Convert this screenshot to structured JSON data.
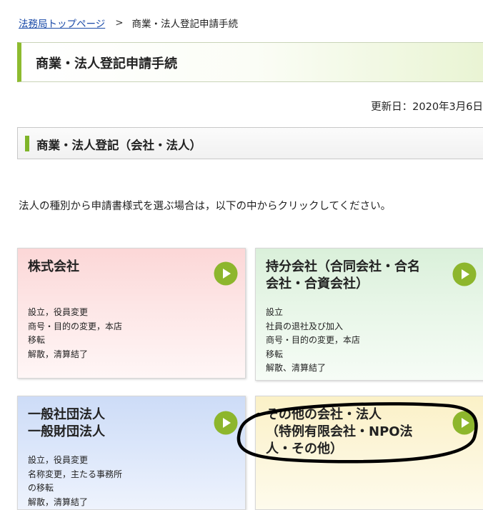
{
  "breadcrumb": {
    "home_link": "法務局トップページ",
    "separator": ">",
    "current": "商業・法人登記申請手続"
  },
  "page_title": "商業・法人登記申請手続",
  "updated": "更新日：2020年3月6日",
  "section_title": "商業・法人登記（会社・法人）",
  "intro": "法人の種別から申請書様式を選ぶ場合は，以下の中からクリックしてください。",
  "cards": [
    {
      "title_lines": [
        "株式会社"
      ],
      "body_lines": [
        "設立，役員変更",
        "商号・目的の変更，本店",
        "移転",
        "解散，清算結了"
      ],
      "color": "#fcd7d7"
    },
    {
      "title_lines": [
        "持分会社（合同会社・合名",
        "会社・合資会社）"
      ],
      "body_lines": [
        "設立",
        "社員の退社及び加入",
        "商号・目的の変更，本店",
        "移転",
        "解散、清算結了"
      ],
      "color": "#daf0da"
    },
    {
      "title_lines": [
        "一般社団法人",
        "一般財団法人"
      ],
      "body_lines": [
        "設立，役員変更",
        "名称変更，主たる事務所",
        "の移転",
        "解散，清算結了"
      ],
      "color": "#cddcf7"
    },
    {
      "title_lines": [
        "その他の会社・法人",
        "（特例有限会社・NPO法",
        "人・その他）"
      ],
      "body_lines": [],
      "color": "#fbf1c7"
    }
  ],
  "icons": {
    "card_link": "play-circle-icon"
  },
  "colors": {
    "accent_green": "#8dbb2f",
    "play_button": "#8db62d",
    "link": "#1a4aa8"
  }
}
